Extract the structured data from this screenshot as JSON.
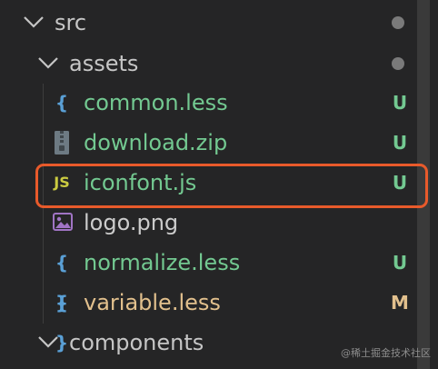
{
  "explorer": {
    "src": {
      "label": "src",
      "status_color": "#7a7a7a"
    },
    "assets": {
      "label": "assets",
      "status_color": "#7a7a7a"
    },
    "files": [
      {
        "label": "common.less",
        "icon": "{ }",
        "icon_name": "braces-icon",
        "icon_color": "#5aa0d6",
        "status": "U",
        "status_color": "#73c991"
      },
      {
        "label": "download.zip",
        "icon_name": "zip-icon",
        "status": "U",
        "status_color": "#73c991"
      },
      {
        "label": "iconfont.js",
        "icon": "JS",
        "icon_name": "js-icon",
        "icon_color": "#cbcb41",
        "status": "U",
        "status_color": "#73c991"
      },
      {
        "label": "logo.png",
        "icon_name": "image-icon",
        "status": "",
        "status_color": ""
      },
      {
        "label": "normalize.less",
        "icon": "{ }",
        "icon_name": "braces-icon",
        "icon_color": "#5aa0d6",
        "status": "U",
        "status_color": "#73c991"
      },
      {
        "label": "variable.less",
        "icon": "{ }",
        "icon_name": "braces-icon",
        "icon_color": "#5aa0d6",
        "status": "M",
        "status_color": "#e2c08d"
      }
    ],
    "components": {
      "label": "components"
    }
  },
  "colors": {
    "background": "#252526",
    "untracked": "#73c991",
    "modified": "#e2c08d",
    "highlight_border": "#e85a2b"
  },
  "watermark": "@稀土掘金技术社区"
}
